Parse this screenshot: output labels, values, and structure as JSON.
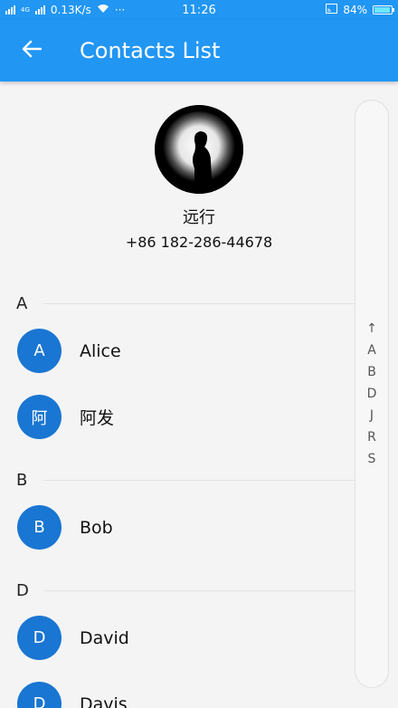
{
  "status_bar": {
    "network_label": "4G",
    "speed": "0.13K/s",
    "more": "···",
    "time": "11:26",
    "battery_percent": "84%"
  },
  "app_bar": {
    "title": "Contacts List",
    "back_icon": "arrow-left-icon"
  },
  "profile": {
    "name": "远行",
    "phone": "+86 182-286-44678"
  },
  "sections": [
    {
      "letter": "A",
      "contacts": [
        {
          "initial": "A",
          "name": "Alice"
        },
        {
          "initial": "阿",
          "name": "阿发"
        }
      ]
    },
    {
      "letter": "B",
      "contacts": [
        {
          "initial": "B",
          "name": "Bob"
        }
      ]
    },
    {
      "letter": "D",
      "contacts": [
        {
          "initial": "D",
          "name": "David"
        },
        {
          "initial": "D",
          "name": "Davis"
        }
      ]
    }
  ],
  "index_bar": [
    "↑",
    "A",
    "B",
    "D",
    "J",
    "R",
    "S"
  ],
  "colors": {
    "primary": "#2196f3",
    "avatar": "#1976d2"
  }
}
